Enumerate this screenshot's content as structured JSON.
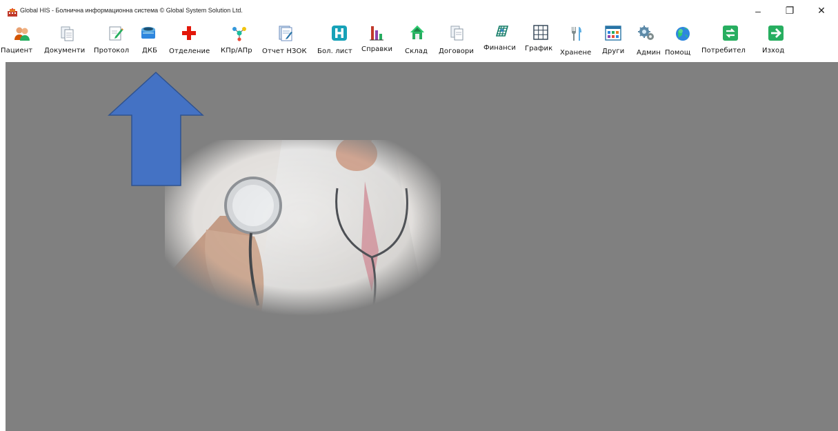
{
  "window": {
    "title": "Global HIS - Болнична информационна система © Global System Solution Ltd.",
    "controls": {
      "minimize": "–",
      "restore": "❐",
      "close": "✕"
    }
  },
  "toolbar": {
    "items": [
      {
        "label": "Пациент",
        "icon": "patients-icon"
      },
      {
        "label": "Документи",
        "icon": "documents-icon"
      },
      {
        "label": "Протокол",
        "icon": "protocol-icon"
      },
      {
        "label": "ДКБ",
        "icon": "dkb-icon"
      },
      {
        "label": "Отделение",
        "icon": "red-cross-icon"
      },
      {
        "label": "КПр/АПр",
        "icon": "molecule-icon"
      },
      {
        "label": "Отчет НЗОК",
        "icon": "report-icon"
      },
      {
        "label": "Бол. лист",
        "icon": "hospital-icon"
      },
      {
        "label": "Справки",
        "icon": "bar-chart-icon"
      },
      {
        "label": "Склад",
        "icon": "warehouse-icon"
      },
      {
        "label": "Договори",
        "icon": "contract-icon"
      },
      {
        "label": "Финанси",
        "icon": "finance-icon"
      },
      {
        "label": "График",
        "icon": "grid-icon"
      },
      {
        "label": "Хранене",
        "icon": "cutlery-icon"
      },
      {
        "label": "Други",
        "icon": "apps-icon"
      },
      {
        "label": "Админ",
        "icon": "gears-icon"
      },
      {
        "label": "Помощ",
        "icon": "help-globe-icon"
      },
      {
        "label": "Потребител",
        "icon": "switch-user-icon"
      },
      {
        "label": "Изход",
        "icon": "exit-icon"
      }
    ]
  },
  "colors": {
    "workspace": "#808080",
    "arrow_fill": "#4472C4",
    "arrow_stroke": "#2F528F"
  }
}
